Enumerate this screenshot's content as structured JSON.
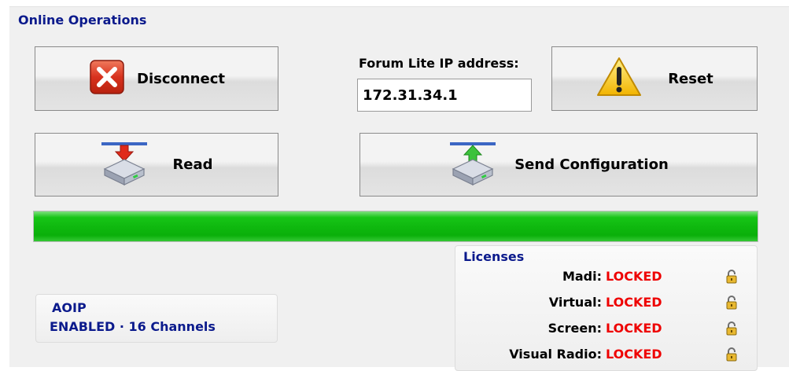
{
  "section_title": "Online Operations",
  "buttons": {
    "disconnect": "Disconnect",
    "reset": "Reset",
    "read": "Read",
    "send_configuration": "Send Configuration"
  },
  "ip": {
    "label": "Forum Lite IP address:",
    "value": "172.31.34.1"
  },
  "progress": {
    "fraction": 1.0,
    "color": "#0fbf0f"
  },
  "aoip": {
    "title": "AOIP",
    "status": "ENABLED · 16 Channels"
  },
  "licenses": {
    "title": "Licenses",
    "items": [
      {
        "name": "Madi:",
        "status": "LOCKED",
        "icon": "padlock-icon"
      },
      {
        "name": "Virtual:",
        "status": "LOCKED",
        "icon": "padlock-icon"
      },
      {
        "name": "Screen:",
        "status": "LOCKED",
        "icon": "padlock-icon"
      },
      {
        "name": "Visual Radio:",
        "status": "LOCKED",
        "icon": "padlock-icon"
      }
    ]
  },
  "colors": {
    "title_blue": "#0b1a8c",
    "locked_red": "#ee0000"
  }
}
